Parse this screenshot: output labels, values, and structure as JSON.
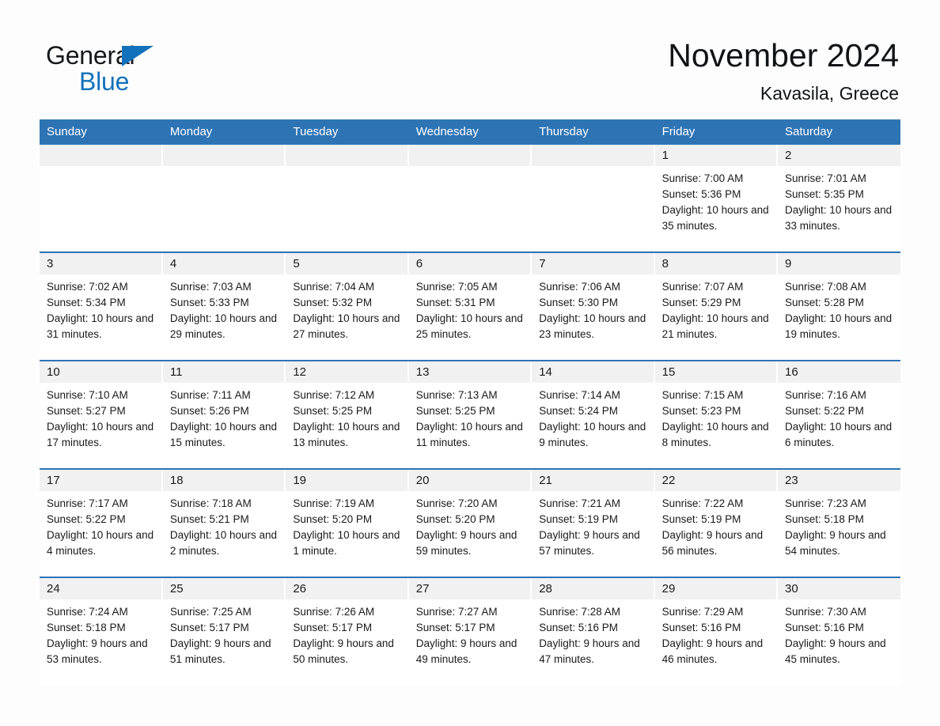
{
  "brand": {
    "name_part1": "General",
    "name_part2": "Blue",
    "logo_icon": "triangle-logo-icon",
    "accent_color": "#1271bb"
  },
  "header": {
    "month_title": "November 2024",
    "location": "Kavasila, Greece"
  },
  "theme": {
    "header_blue": "#2e74b5",
    "daynum_gray": "#f1f1f1",
    "page_background": "#fdfdfd"
  },
  "calendar": {
    "weekday_headers": [
      "Sunday",
      "Monday",
      "Tuesday",
      "Wednesday",
      "Thursday",
      "Friday",
      "Saturday"
    ],
    "weeks": [
      [
        {
          "empty": true
        },
        {
          "empty": true
        },
        {
          "empty": true
        },
        {
          "empty": true
        },
        {
          "empty": true
        },
        {
          "day": "1",
          "sunrise": "Sunrise: 7:00 AM",
          "sunset": "Sunset: 5:36 PM",
          "daylight": "Daylight: 10 hours and 35 minutes."
        },
        {
          "day": "2",
          "sunrise": "Sunrise: 7:01 AM",
          "sunset": "Sunset: 5:35 PM",
          "daylight": "Daylight: 10 hours and 33 minutes."
        }
      ],
      [
        {
          "day": "3",
          "sunrise": "Sunrise: 7:02 AM",
          "sunset": "Sunset: 5:34 PM",
          "daylight": "Daylight: 10 hours and 31 minutes."
        },
        {
          "day": "4",
          "sunrise": "Sunrise: 7:03 AM",
          "sunset": "Sunset: 5:33 PM",
          "daylight": "Daylight: 10 hours and 29 minutes."
        },
        {
          "day": "5",
          "sunrise": "Sunrise: 7:04 AM",
          "sunset": "Sunset: 5:32 PM",
          "daylight": "Daylight: 10 hours and 27 minutes."
        },
        {
          "day": "6",
          "sunrise": "Sunrise: 7:05 AM",
          "sunset": "Sunset: 5:31 PM",
          "daylight": "Daylight: 10 hours and 25 minutes."
        },
        {
          "day": "7",
          "sunrise": "Sunrise: 7:06 AM",
          "sunset": "Sunset: 5:30 PM",
          "daylight": "Daylight: 10 hours and 23 minutes."
        },
        {
          "day": "8",
          "sunrise": "Sunrise: 7:07 AM",
          "sunset": "Sunset: 5:29 PM",
          "daylight": "Daylight: 10 hours and 21 minutes."
        },
        {
          "day": "9",
          "sunrise": "Sunrise: 7:08 AM",
          "sunset": "Sunset: 5:28 PM",
          "daylight": "Daylight: 10 hours and 19 minutes."
        }
      ],
      [
        {
          "day": "10",
          "sunrise": "Sunrise: 7:10 AM",
          "sunset": "Sunset: 5:27 PM",
          "daylight": "Daylight: 10 hours and 17 minutes."
        },
        {
          "day": "11",
          "sunrise": "Sunrise: 7:11 AM",
          "sunset": "Sunset: 5:26 PM",
          "daylight": "Daylight: 10 hours and 15 minutes."
        },
        {
          "day": "12",
          "sunrise": "Sunrise: 7:12 AM",
          "sunset": "Sunset: 5:25 PM",
          "daylight": "Daylight: 10 hours and 13 minutes."
        },
        {
          "day": "13",
          "sunrise": "Sunrise: 7:13 AM",
          "sunset": "Sunset: 5:25 PM",
          "daylight": "Daylight: 10 hours and 11 minutes."
        },
        {
          "day": "14",
          "sunrise": "Sunrise: 7:14 AM",
          "sunset": "Sunset: 5:24 PM",
          "daylight": "Daylight: 10 hours and 9 minutes."
        },
        {
          "day": "15",
          "sunrise": "Sunrise: 7:15 AM",
          "sunset": "Sunset: 5:23 PM",
          "daylight": "Daylight: 10 hours and 8 minutes."
        },
        {
          "day": "16",
          "sunrise": "Sunrise: 7:16 AM",
          "sunset": "Sunset: 5:22 PM",
          "daylight": "Daylight: 10 hours and 6 minutes."
        }
      ],
      [
        {
          "day": "17",
          "sunrise": "Sunrise: 7:17 AM",
          "sunset": "Sunset: 5:22 PM",
          "daylight": "Daylight: 10 hours and 4 minutes."
        },
        {
          "day": "18",
          "sunrise": "Sunrise: 7:18 AM",
          "sunset": "Sunset: 5:21 PM",
          "daylight": "Daylight: 10 hours and 2 minutes."
        },
        {
          "day": "19",
          "sunrise": "Sunrise: 7:19 AM",
          "sunset": "Sunset: 5:20 PM",
          "daylight": "Daylight: 10 hours and 1 minute."
        },
        {
          "day": "20",
          "sunrise": "Sunrise: 7:20 AM",
          "sunset": "Sunset: 5:20 PM",
          "daylight": "Daylight: 9 hours and 59 minutes."
        },
        {
          "day": "21",
          "sunrise": "Sunrise: 7:21 AM",
          "sunset": "Sunset: 5:19 PM",
          "daylight": "Daylight: 9 hours and 57 minutes."
        },
        {
          "day": "22",
          "sunrise": "Sunrise: 7:22 AM",
          "sunset": "Sunset: 5:19 PM",
          "daylight": "Daylight: 9 hours and 56 minutes."
        },
        {
          "day": "23",
          "sunrise": "Sunrise: 7:23 AM",
          "sunset": "Sunset: 5:18 PM",
          "daylight": "Daylight: 9 hours and 54 minutes."
        }
      ],
      [
        {
          "day": "24",
          "sunrise": "Sunrise: 7:24 AM",
          "sunset": "Sunset: 5:18 PM",
          "daylight": "Daylight: 9 hours and 53 minutes."
        },
        {
          "day": "25",
          "sunrise": "Sunrise: 7:25 AM",
          "sunset": "Sunset: 5:17 PM",
          "daylight": "Daylight: 9 hours and 51 minutes."
        },
        {
          "day": "26",
          "sunrise": "Sunrise: 7:26 AM",
          "sunset": "Sunset: 5:17 PM",
          "daylight": "Daylight: 9 hours and 50 minutes."
        },
        {
          "day": "27",
          "sunrise": "Sunrise: 7:27 AM",
          "sunset": "Sunset: 5:17 PM",
          "daylight": "Daylight: 9 hours and 49 minutes."
        },
        {
          "day": "28",
          "sunrise": "Sunrise: 7:28 AM",
          "sunset": "Sunset: 5:16 PM",
          "daylight": "Daylight: 9 hours and 47 minutes."
        },
        {
          "day": "29",
          "sunrise": "Sunrise: 7:29 AM",
          "sunset": "Sunset: 5:16 PM",
          "daylight": "Daylight: 9 hours and 46 minutes."
        },
        {
          "day": "30",
          "sunrise": "Sunrise: 7:30 AM",
          "sunset": "Sunset: 5:16 PM",
          "daylight": "Daylight: 9 hours and 45 minutes."
        }
      ]
    ]
  }
}
